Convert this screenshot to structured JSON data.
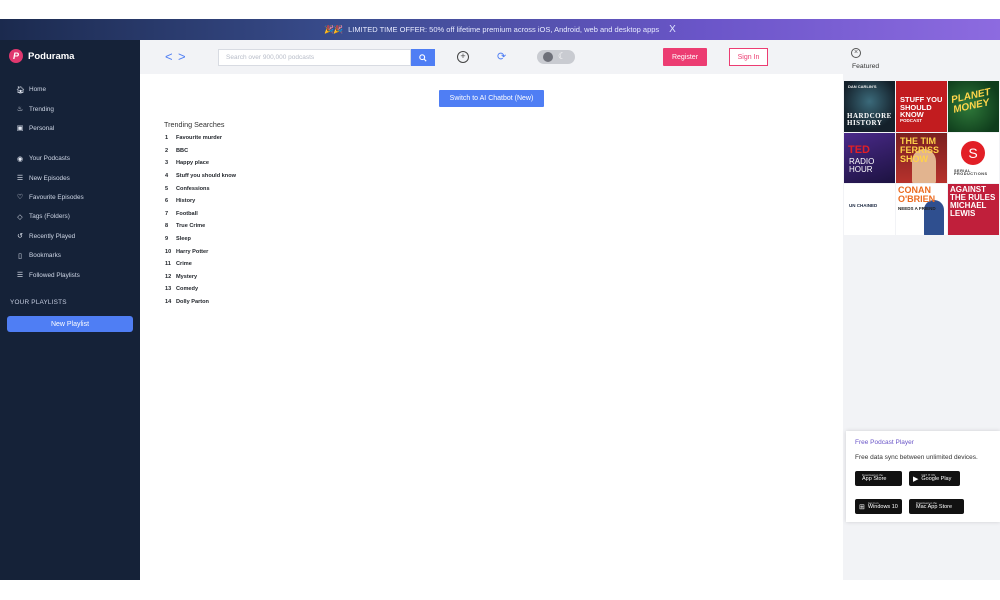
{
  "promo": {
    "text": "LIMITED TIME OFFER: 50% off lifetime premium across iOS, Android, web and desktop apps",
    "close": "X"
  },
  "app": {
    "name": "Podurama",
    "logo_letter": "P"
  },
  "sidebar": {
    "main_items": [
      {
        "label": "Home",
        "icon": "home-icon"
      },
      {
        "label": "Trending",
        "icon": "flame-icon"
      },
      {
        "label": "Personal",
        "icon": "gift-icon"
      }
    ],
    "library_items": [
      {
        "label": "Your Podcasts",
        "icon": "podcast-icon"
      },
      {
        "label": "New Episodes",
        "icon": "list-icon"
      },
      {
        "label": "Favourite Episodes",
        "icon": "heart-icon"
      },
      {
        "label": "Tags (Folders)",
        "icon": "tag-icon"
      },
      {
        "label": "Recently Played",
        "icon": "history-icon"
      },
      {
        "label": "Bookmarks",
        "icon": "bookmark-icon"
      },
      {
        "label": "Followed Playlists",
        "icon": "list-icon"
      }
    ],
    "playlists_title": "YOUR PLAYLISTS",
    "new_playlist_label": "New Playlist"
  },
  "header": {
    "search_placeholder": "Search over 900,000 podcasts",
    "register_label": "Register",
    "signin_label": "Sign In"
  },
  "main": {
    "chatbot_label": "Switch to AI Chatbot (New)",
    "trending_title": "Trending Searches",
    "trending": [
      {
        "num": "1",
        "label": "Favourite murder"
      },
      {
        "num": "2",
        "label": "BBC"
      },
      {
        "num": "3",
        "label": "Happy place"
      },
      {
        "num": "4",
        "label": "Stuff you should know"
      },
      {
        "num": "5",
        "label": "Confessions"
      },
      {
        "num": "6",
        "label": "History"
      },
      {
        "num": "7",
        "label": "Football"
      },
      {
        "num": "8",
        "label": "True Crime"
      },
      {
        "num": "9",
        "label": "Sleep"
      },
      {
        "num": "10",
        "label": "Harry Potter"
      },
      {
        "num": "11",
        "label": "Crime"
      },
      {
        "num": "12",
        "label": "Mystery"
      },
      {
        "num": "13",
        "label": "Comedy"
      },
      {
        "num": "14",
        "label": "Dolly Parton"
      }
    ]
  },
  "featured": {
    "title": "Featured",
    "tiles": {
      "t1_top": "DAN CARLIN'S",
      "t1_big": "HARDCORE HISTORY",
      "t2_big": "STUFF YOU SHOULD KNOW",
      "t2_sub": "PODCAST",
      "t3_big": "PLANET MONEY",
      "t4_big": "TED",
      "t4_sub": "RADIO HOUR",
      "t5_big": "THE TIM FERRISS SHOW",
      "t6_logo": "S",
      "t6_sub": "SERIAL PRODUCTIONS",
      "t7_big": "UN CHAINED",
      "t8_big": "CONAN O'BRIEN",
      "t8_sub": "NEEDS A FRIEND",
      "t9_big": "AGAINST THE RULES MICHAEL LEWIS"
    }
  },
  "player": {
    "title": "Free Podcast Player",
    "desc": "Free data sync between unlimited devices.",
    "stores": [
      {
        "small": "Download on the",
        "big": "App Store"
      },
      {
        "small": "GET IT ON",
        "big": "Google Play"
      },
      {
        "small": "Get it on",
        "big": "Windows 10"
      },
      {
        "small": "Download on the",
        "big": "Mac App Store"
      }
    ]
  },
  "colors": {
    "accent": "#4f7ef4",
    "brand_pink": "#ec3c72",
    "sidebar_bg": "#152238"
  }
}
